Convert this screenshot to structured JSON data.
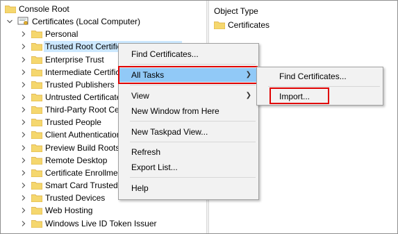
{
  "tree": {
    "root": "Console Root",
    "certificates": "Certificates (Local Computer)",
    "items": [
      "Personal",
      "Trusted Root Certification Authorities",
      "Enterprise Trust",
      "Intermediate Certification Authorities",
      "Trusted Publishers",
      "Untrusted Certificates",
      "Third-Party Root Certification Authorities",
      "Trusted People",
      "Client Authentication Issuers",
      "Preview Build Roots",
      "Remote Desktop",
      "Certificate Enrollment Requests",
      "Smart Card Trusted Roots",
      "Trusted Devices",
      "Web Hosting",
      "Windows Live ID Token Issuer"
    ]
  },
  "right_pane": {
    "column_header": "Object Type",
    "items": [
      "Certificates"
    ]
  },
  "context_menu": {
    "find_certificates": "Find Certificates...",
    "all_tasks": "All Tasks",
    "view": "View",
    "new_window": "New Window from Here",
    "new_taskpad": "New Taskpad View...",
    "refresh": "Refresh",
    "export_list": "Export List...",
    "help": "Help"
  },
  "submenu": {
    "find_certificates": "Find Certificates...",
    "import": "Import..."
  },
  "colors": {
    "highlight": "#91c9f7",
    "selection": "#cce8ff",
    "annotation_red": "#e00000",
    "folder": "#f5d76e"
  }
}
